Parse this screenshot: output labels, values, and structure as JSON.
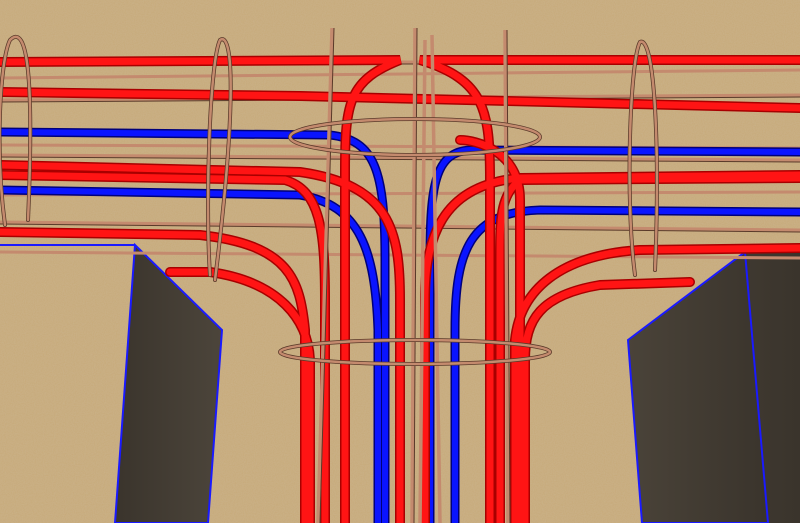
{
  "scene": {
    "description_label": "",
    "colors": {
      "background": "#c7a978",
      "background_speckle": "#9c7d52",
      "wall_face": "#4a4339",
      "wall_face_dark": "#3c362e",
      "wall_outline": "#1a1aff",
      "red_bar": "#ff1414",
      "red_bar_dark": "#a80000",
      "blue_bar": "#0a14ff",
      "blue_bar_dark": "#00007a",
      "stirrup": "#c48a6e",
      "stirrup_dark": "#5a3a2a"
    },
    "elements": {
      "left_wall": "concrete-wall-left",
      "right_wall": "concrete-wall-right",
      "red_bars": "longitudinal-red-rebar",
      "blue_bars": "longitudinal-blue-rebar",
      "stirrups": "tie-stirrups"
    }
  }
}
